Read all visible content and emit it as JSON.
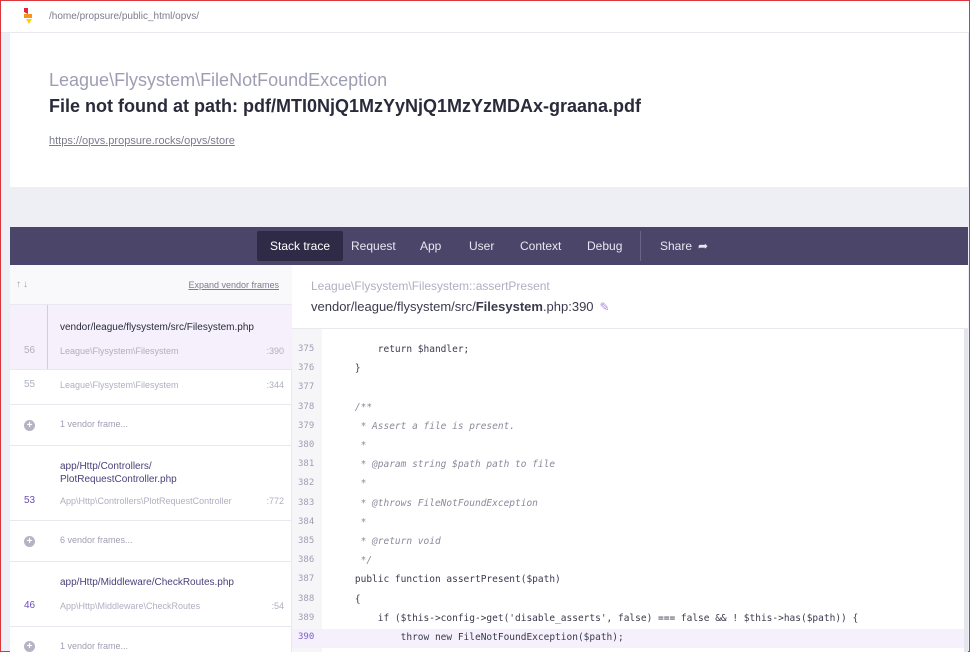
{
  "topbar": {
    "path": "/home/propsure/public_html/opvs/"
  },
  "header": {
    "exception_class": "League\\Flysystem\\FileNotFoundException",
    "exception_message": "File not found at path: pdf/MTI0NjQ1MzYyNjQ1MzYzMDAx-graana.pdf",
    "url": "https://opvs.propsure.rocks/opvs/store"
  },
  "nav": {
    "tabs": [
      "Stack trace",
      "Request",
      "App",
      "User",
      "Context",
      "Debug"
    ],
    "share_label": "Share",
    "active": "Stack trace"
  },
  "stack": {
    "expand_label": "Expand vendor frames",
    "frames": [
      {
        "file": "vendor/league/flysystem/src/Filesystem.php",
        "line": "56",
        "class": "League\\Flysystem\\Filesystem",
        "col": ":390",
        "selected": true
      },
      {
        "file": "",
        "line": "55",
        "class": "League\\Flysystem\\Filesystem",
        "col": ":344"
      },
      {
        "vendor": "1 vendor frame..."
      },
      {
        "file": "app/Http/Controllers/\nPlotRequestController.php",
        "line": "53",
        "class": "App\\Http\\Controllers\\PlotRequestController",
        "col": ":772"
      },
      {
        "vendor": "6 vendor frames..."
      },
      {
        "file": "app/Http/Middleware/CheckRoutes.php",
        "line": "46",
        "class": "App\\Http\\Middleware\\CheckRoutes",
        "col": ":54"
      },
      {
        "vendor": "1 vendor frame..."
      }
    ]
  },
  "code_view": {
    "class": "League\\Flysystem\\Filesystem::assertPresent",
    "file_prefix": "vendor/league/flysystem/src/",
    "file_name": "Filesystem",
    "file_suffix": ".php:390",
    "lines": [
      {
        "n": "375",
        "code": "        return $handler;"
      },
      {
        "n": "376",
        "code": "    }"
      },
      {
        "n": "377",
        "code": ""
      },
      {
        "n": "378",
        "code": "    /**",
        "comment": true
      },
      {
        "n": "379",
        "code": "     * Assert a file is present.",
        "comment": true
      },
      {
        "n": "380",
        "code": "     *",
        "comment": true
      },
      {
        "n": "381",
        "code": "     * @param string $path path to file",
        "comment": true
      },
      {
        "n": "382",
        "code": "     *",
        "comment": true
      },
      {
        "n": "383",
        "code": "     * @throws FileNotFoundException",
        "comment": true
      },
      {
        "n": "384",
        "code": "     *",
        "comment": true
      },
      {
        "n": "385",
        "code": "     * @return void",
        "comment": true
      },
      {
        "n": "386",
        "code": "     */",
        "comment": true
      },
      {
        "n": "387",
        "code": "    public function assertPresent($path)"
      },
      {
        "n": "388",
        "code": "    {"
      },
      {
        "n": "389",
        "code": "        if ($this->config->get('disable_asserts', false) === false && ! $this->has($path)) {"
      },
      {
        "n": "390",
        "code": "            throw new FileNotFoundException($path);",
        "highlight": true
      }
    ]
  }
}
